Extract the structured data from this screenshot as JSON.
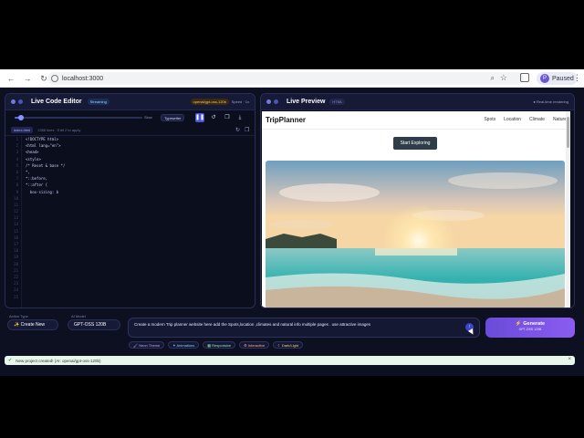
{
  "browser": {
    "url": "localhost:3000",
    "profile_initial": "P",
    "profile_name": "Paused"
  },
  "editor": {
    "title": "Live Code Editor",
    "status_badge": "Streaming",
    "model_badge": "openai/gpt-oss-120b",
    "speed": "Slow",
    "speed_select": "Typewriter",
    "file_badge": "index.html",
    "file_info": "2356 lines · Edit 2 to apply",
    "progress_fraction": 0.05,
    "code_lines": [
      "<!DOCTYPE html>",
      "<html lang=\"en\">",
      "<head>",
      "<style>",
      "/* Reset & base */",
      "*,",
      "*::before,",
      "*::after {",
      "  box-sizing: b",
      "",
      "",
      "",
      "",
      "",
      "",
      "",
      "",
      "",
      "",
      "",
      "",
      "",
      "",
      "",
      ""
    ]
  },
  "preview": {
    "title": "Live Preview",
    "tag": "HTML",
    "live_label": "● Real-time rendering",
    "site": {
      "brand": "TripPlanner",
      "nav": [
        "Spots",
        "Location",
        "Climate",
        "Nature"
      ],
      "cta": "Start Exploring"
    }
  },
  "prompt": {
    "action_type_label": "Action Type",
    "create_new": "✨ Create New",
    "ai_model_label": "AI Model",
    "model": "GPT-OSS 120B",
    "input_text": "Create a modern Trip planner  website here add the Spots,location ,climates and natural info multiple pages . use attractive images",
    "generate_label": "⚡ Generate",
    "generate_sub": "GPT-OSS 120B",
    "chips": [
      {
        "label": "🖌 Neon Theme",
        "color": "#c7a0ff"
      },
      {
        "label": "✦ Animations",
        "color": "#7fd3ff"
      },
      {
        "label": "▦ Responsive",
        "color": "#8ef0b3"
      },
      {
        "label": "⚙ Interactive",
        "color": "#ffb085"
      },
      {
        "label": "☾ Dark/Light",
        "color": "#f5d76e"
      }
    ]
  },
  "toast": {
    "message": "New project created! (AI: openai/gpt-oss-120b)"
  },
  "colors": {
    "accent": "#5b6bd8",
    "generate": "#8a5cf0"
  }
}
